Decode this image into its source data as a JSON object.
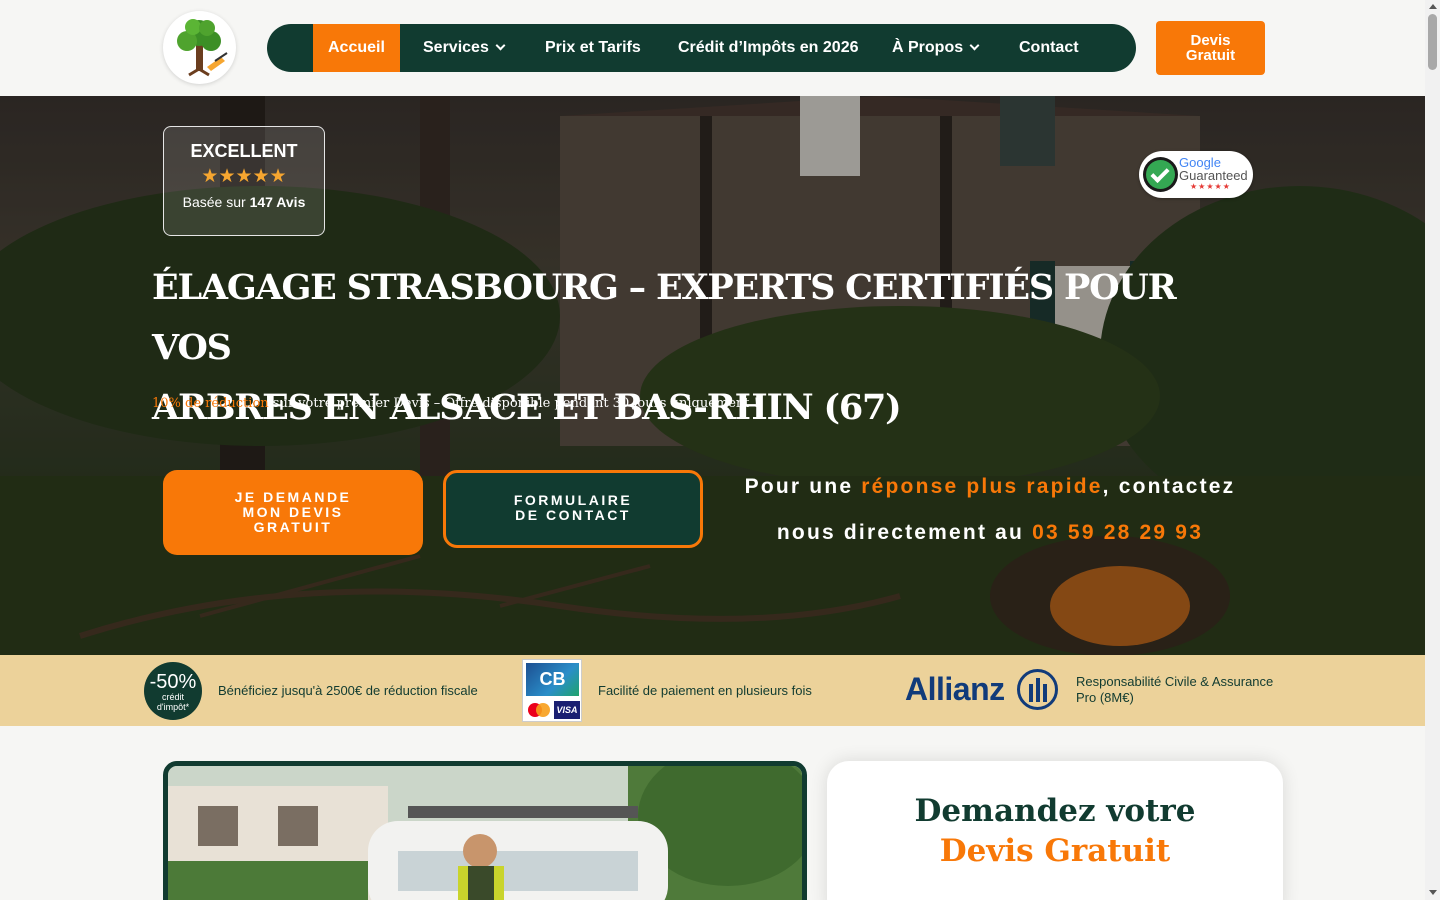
{
  "header": {
    "nav": [
      {
        "label": "Accueil",
        "active": true
      },
      {
        "label": "Services",
        "dropdown": true
      },
      {
        "label": "Prix et Tarifs"
      },
      {
        "label": "Crédit d’Impôts en 2026"
      },
      {
        "label": "À Propos",
        "dropdown": true
      },
      {
        "label": "Contact"
      }
    ],
    "cta_line1": "Devis",
    "cta_line2": "Gratuit"
  },
  "hero": {
    "reviews": {
      "rating_label": "EXCELLENT",
      "stars": "★★★★★",
      "based_prefix": "Basée sur",
      "based_count": "147 Avis"
    },
    "google_badge": {
      "google": "Google",
      "guaranteed": "Guaranteed",
      "stars": "★★★★★"
    },
    "title_line1": "ÉLAGAGE STRASBOURG – EXPERTS CERTIFIÉS POUR VOS",
    "title_line2": "ARBRES EN ALSACE ET BAS-RHIN (67)",
    "offer_highlight": "10% de réduction",
    "offer_rest": "sur votre premier Devis – Offre disponible pendant 30 jours uniquement !",
    "btn_devis_l1": "JE DEMANDE",
    "btn_devis_l2": "MON DEVIS",
    "btn_devis_l3": "GRATUIT",
    "btn_contact_l1": "FORMULAIRE",
    "btn_contact_l2": "DE CONTACT",
    "phone_text_1": "Pour une",
    "phone_highlight": "réponse plus rapide",
    "phone_text_2": ", contactez",
    "phone_text_3": "nous directement au",
    "phone_number": "03 59 28 29 93"
  },
  "trust": {
    "tax_pct": "-50%",
    "tax_sub1": "crédit",
    "tax_sub2": "d'impôt*",
    "tax_text": "Bénéficiez jusqu'à 2500€ de réduction fiscale",
    "cb_label": "CB",
    "visa_label": "VISA",
    "payment_text": "Facilité de paiement en plusieurs fois",
    "allianz": "Allianz",
    "insurance_l1": "Responsabilité Civile & Assurance",
    "insurance_l2": "Pro (8M€)"
  },
  "form": {
    "title_line1": "Demandez votre",
    "title_line2": "Devis Gratuit"
  },
  "colors": {
    "brand_green": "#113b30",
    "accent_orange": "#f87808",
    "band_beige": "#ecd29a"
  }
}
